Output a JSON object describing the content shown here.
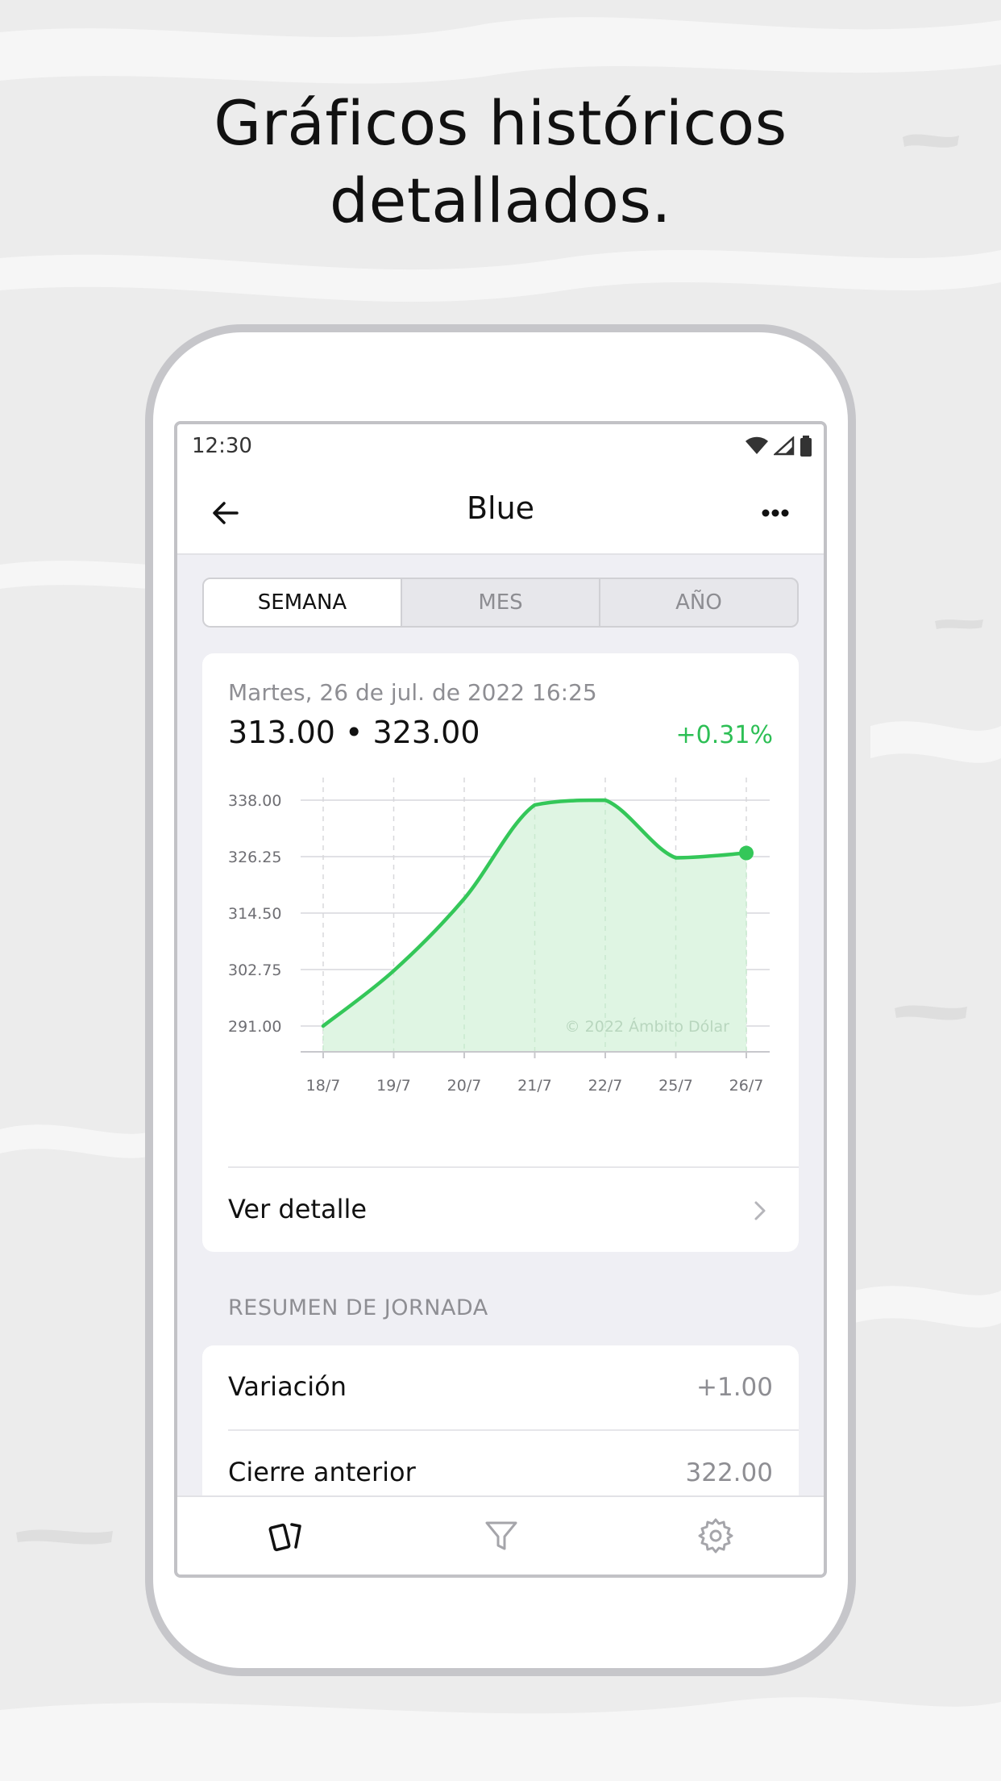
{
  "headline": {
    "line1": "Gráficos históricos",
    "line2": "detallados."
  },
  "status_bar": {
    "time": "12:30",
    "icons": [
      "wifi-icon",
      "signal-icon",
      "battery-icon"
    ]
  },
  "nav": {
    "title": "Blue",
    "back_icon": "arrow-left-icon",
    "more_icon": "more-horizontal-icon"
  },
  "tabs": [
    {
      "label": "SEMANA",
      "active": true
    },
    {
      "label": "MES",
      "active": false
    },
    {
      "label": "AÑO",
      "active": false
    }
  ],
  "quote": {
    "date": "Martes, 26 de jul. de 2022 16:25",
    "price": "313.00 • 323.00",
    "change": "+0.31%"
  },
  "chart_data": {
    "type": "area",
    "categories": [
      "18/7",
      "19/7",
      "20/7",
      "21/7",
      "22/7",
      "25/7",
      "26/7"
    ],
    "values": [
      291.0,
      302.5,
      317.5,
      337.0,
      338.0,
      326.0,
      327.0
    ],
    "ylim": [
      291.0,
      338.0
    ],
    "yticks": [
      "338.00",
      "326.25",
      "314.50",
      "302.75",
      "291.00"
    ],
    "ytick_values": [
      338.0,
      326.25,
      314.5,
      302.75,
      291.0
    ],
    "watermark": "© 2022 Ámbito Dólar",
    "color": "#34c759",
    "fill": "#dff5e3",
    "grid": true
  },
  "detail": {
    "label": "Ver detalle"
  },
  "summary": {
    "section_title": "RESUMEN DE JORNADA",
    "rows": [
      {
        "label": "Variación",
        "value": "+1.00"
      },
      {
        "label": "Cierre anterior",
        "value": "322.00"
      }
    ]
  },
  "tabbar": {
    "items": [
      "cards-icon",
      "filter-icon",
      "settings-icon"
    ]
  }
}
